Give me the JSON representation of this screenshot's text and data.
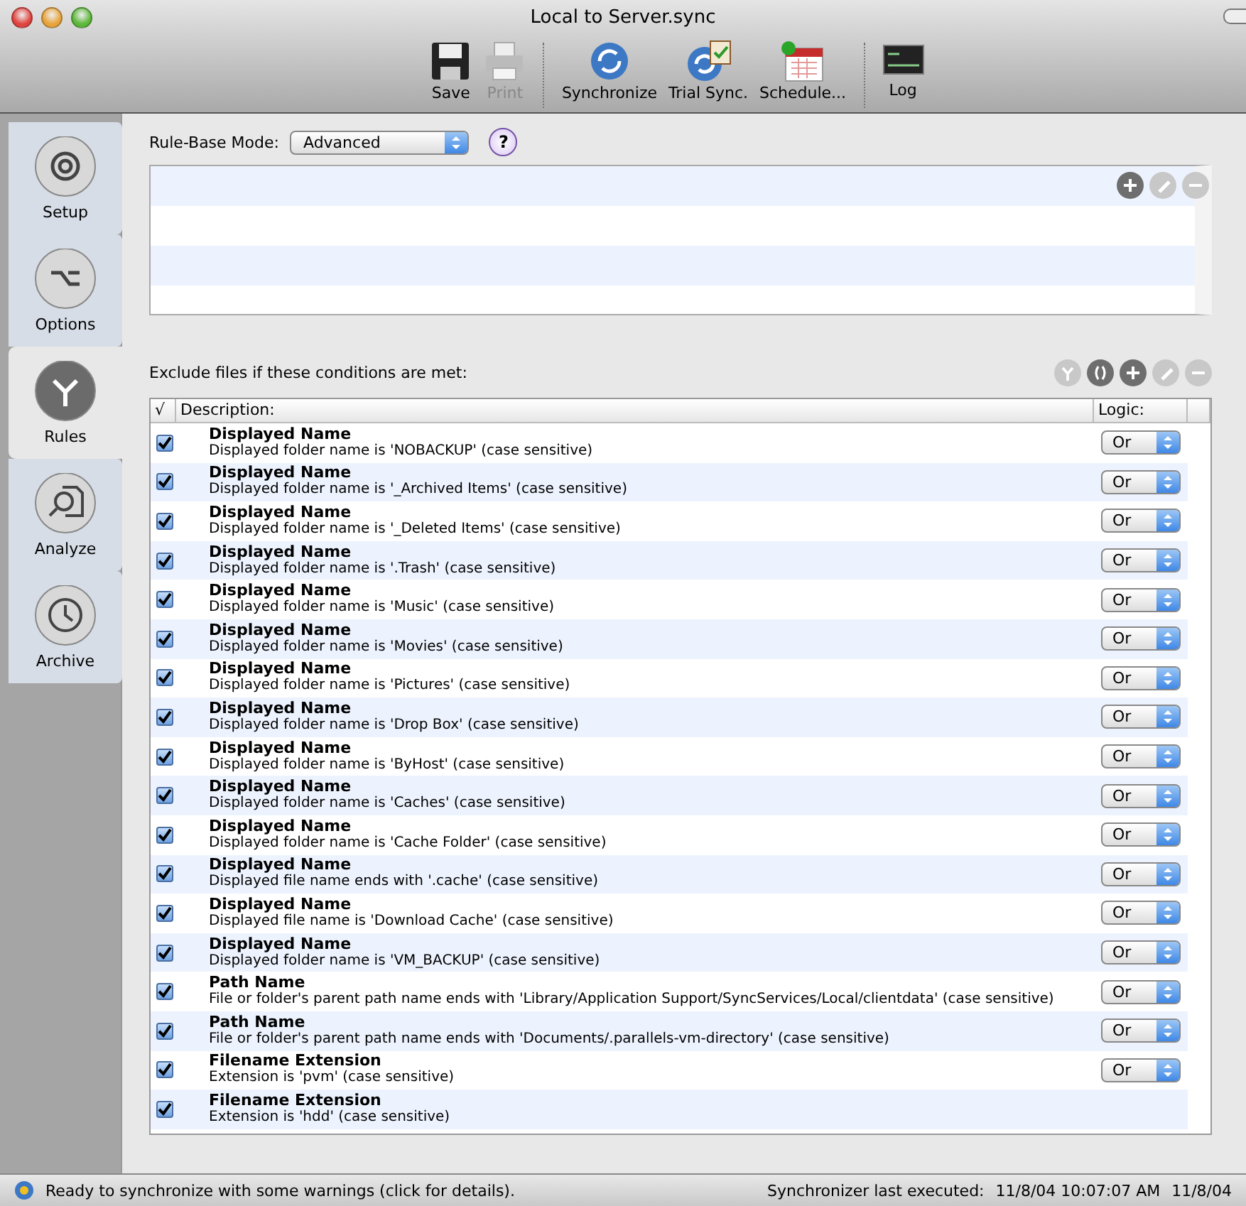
{
  "window": {
    "title": "Local to Server.sync"
  },
  "toolbar": [
    {
      "label": "Save",
      "disabled": false
    },
    {
      "label": "Print",
      "disabled": true
    },
    {
      "label": "Synchronize",
      "disabled": false
    },
    {
      "label": "Trial Sync.",
      "disabled": false
    },
    {
      "label": "Schedule...",
      "disabled": false
    },
    {
      "label": "Log",
      "disabled": false
    }
  ],
  "sidebar": {
    "items": [
      {
        "label": "Setup",
        "selected": false
      },
      {
        "label": "Options",
        "selected": false
      },
      {
        "label": "Rules",
        "selected": true
      },
      {
        "label": "Analyze",
        "selected": false
      },
      {
        "label": "Archive",
        "selected": false
      }
    ]
  },
  "rule_base": {
    "label": "Rule-Base Mode:",
    "value": "Advanced",
    "help": "?"
  },
  "top_list": {
    "actions": [
      {
        "disabled": false
      },
      {
        "disabled": true
      },
      {
        "disabled": true
      }
    ]
  },
  "exclude": {
    "label": "Exclude files if these conditions are met:",
    "actions": [
      {
        "disabled": true
      },
      {
        "disabled": false
      },
      {
        "disabled": false
      },
      {
        "disabled": true
      },
      {
        "disabled": true
      }
    ],
    "columns": [
      "√",
      "Description:",
      "Logic:"
    ],
    "rows": [
      {
        "checked": true,
        "title": "Displayed Name",
        "description": "Displayed folder name is 'NOBACKUP' (case sensitive)",
        "logic": "Or"
      },
      {
        "checked": true,
        "title": "Displayed Name",
        "description": "Displayed folder name is '_Archived Items' (case sensitive)",
        "logic": "Or"
      },
      {
        "checked": true,
        "title": "Displayed Name",
        "description": "Displayed folder name is '_Deleted Items' (case sensitive)",
        "logic": "Or"
      },
      {
        "checked": true,
        "title": "Displayed Name",
        "description": "Displayed folder name is '.Trash' (case sensitive)",
        "logic": "Or"
      },
      {
        "checked": true,
        "title": "Displayed Name",
        "description": "Displayed folder name is 'Music' (case sensitive)",
        "logic": "Or"
      },
      {
        "checked": true,
        "title": "Displayed Name",
        "description": "Displayed folder name is 'Movies' (case sensitive)",
        "logic": "Or"
      },
      {
        "checked": true,
        "title": "Displayed Name",
        "description": "Displayed folder name is 'Pictures' (case sensitive)",
        "logic": "Or"
      },
      {
        "checked": true,
        "title": "Displayed Name",
        "description": "Displayed folder name is 'Drop Box' (case sensitive)",
        "logic": "Or"
      },
      {
        "checked": true,
        "title": "Displayed Name",
        "description": "Displayed folder name is 'ByHost' (case sensitive)",
        "logic": "Or"
      },
      {
        "checked": true,
        "title": "Displayed Name",
        "description": "Displayed folder name is 'Caches' (case sensitive)",
        "logic": "Or"
      },
      {
        "checked": true,
        "title": "Displayed Name",
        "description": "Displayed folder name is 'Cache Folder' (case sensitive)",
        "logic": "Or"
      },
      {
        "checked": true,
        "title": "Displayed Name",
        "description": "Displayed file name ends with '.cache' (case sensitive)",
        "logic": "Or"
      },
      {
        "checked": true,
        "title": "Displayed Name",
        "description": "Displayed file name is 'Download Cache' (case sensitive)",
        "logic": "Or"
      },
      {
        "checked": true,
        "title": "Displayed Name",
        "description": "Displayed folder name is 'VM_BACKUP' (case sensitive)",
        "logic": "Or"
      },
      {
        "checked": true,
        "title": "Path Name",
        "description": "File or folder's parent path name ends with 'Library/Application Support/SyncServices/Local/clientdata' (case sensitive)",
        "logic": "Or"
      },
      {
        "checked": true,
        "title": "Path Name",
        "description": "File or folder's parent path name ends with 'Documents/.parallels-vm-directory' (case sensitive)",
        "logic": "Or"
      },
      {
        "checked": true,
        "title": "Filename Extension",
        "description": "Extension is 'pvm' (case sensitive)",
        "logic": "Or"
      },
      {
        "checked": true,
        "title": "Filename Extension",
        "description": "Extension is 'hdd' (case sensitive)"
      }
    ]
  },
  "status_bar": {
    "message": "Ready to synchronize with some warnings (click for details).",
    "last_label": "Synchronizer last executed:",
    "last_time": "11/8/04 10:07:07 AM",
    "date": "11/8/04"
  }
}
